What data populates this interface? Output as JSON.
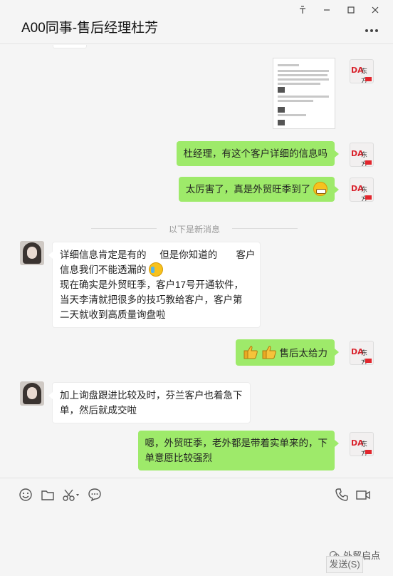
{
  "window": {
    "title": "A00同事-售后经理杜芳",
    "pin_glyph": "ᅮ",
    "minimize_glyph": "—",
    "maximize_glyph": "☐",
    "close_glyph": "✕",
    "more_glyph": "•••"
  },
  "chat": {
    "new_messages_divider": "以下是新消息",
    "messages": [
      {
        "from": "me",
        "lines": [
          "杜经理，有这个客户详细的信息吗"
        ]
      },
      {
        "from": "me",
        "lines": [
          "太厉害了，真是外贸旺季到了"
        ],
        "emoji": "grin"
      },
      {
        "from": "them",
        "lines": [
          "详细信息肯定是有的     但是你知道的       客户",
          "信息我们不能透漏的",
          "现在确实是外贸旺季，客户17号开通软件，",
          "当天李清就把很多的技巧教给客户，客户第",
          "二天就收到高质量询盘啦"
        ],
        "emoji": "cry"
      },
      {
        "from": "me",
        "lines": [
          "售后太给力"
        ],
        "emoji": "thumbs-up"
      },
      {
        "from": "them",
        "lines": [
          "加上询盘跟进比较及时，芬兰客户也着急下",
          "单，然后就成交啦"
        ]
      },
      {
        "from": "me",
        "lines": [
          "嗯，外贸旺季，老外都是带着实单来的，下",
          "单意愿比较强烈"
        ]
      }
    ],
    "avatar_me_text": "DA东方",
    "colors": {
      "me_bubble": "#9eea6a",
      "them_bubble": "#ffffff",
      "background": "#f5f5f5"
    }
  },
  "toolbar": {
    "icons": [
      "emoji-icon",
      "folder-icon",
      "scissors-icon",
      "chat-bubble-icon",
      "phone-icon",
      "video-icon"
    ]
  },
  "input": {
    "send_label": "发送(S)"
  },
  "watermark": {
    "text": "外贸启点"
  }
}
